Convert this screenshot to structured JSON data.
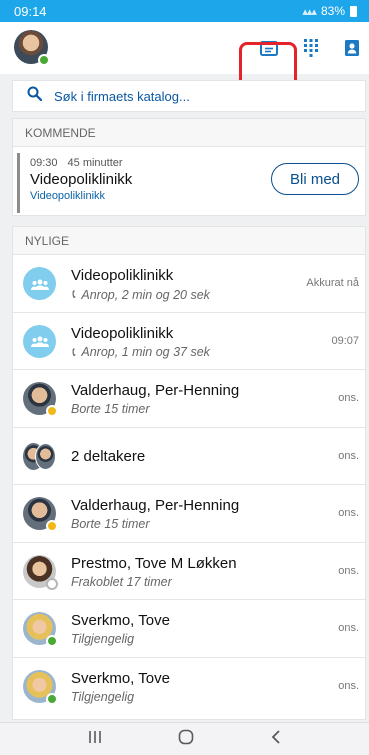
{
  "status_bar": {
    "time": "09:14",
    "battery": "83%"
  },
  "search": {
    "placeholder": "Søk i firmaets katalog..."
  },
  "upcoming": {
    "header": "KOMMENDE",
    "meeting": {
      "time": "09:30",
      "duration": "45 minutter",
      "title": "Videopoliklinikk",
      "subtitle": "Videopoliklinikk",
      "join_label": "Bli med"
    }
  },
  "recent": {
    "header": "NYLIGE",
    "items": [
      {
        "name": "Videopoliklinikk",
        "detail": "Anrop, 2 min og 20 sek",
        "time": "Akkurat nå",
        "avatar": "group-icon"
      },
      {
        "name": "Videopoliklinikk",
        "detail": "Anrop, 1 min og 37 sek",
        "time": "09:07",
        "avatar": "group-icon"
      },
      {
        "name": "Valderhaug, Per-Henning",
        "detail": "Borte 15 timer",
        "time": "ons.",
        "presence": "away"
      },
      {
        "name": "2 deltakere",
        "detail": "",
        "time": "ons."
      },
      {
        "name": "Valderhaug, Per-Henning",
        "detail": "Borte 15 timer",
        "time": "ons.",
        "presence": "away"
      },
      {
        "name": "Prestmo, Tove M Løkken",
        "detail": "Frakoblet 17 timer",
        "time": "ons.",
        "presence": "offline"
      },
      {
        "name": "Sverkmo, Tove",
        "detail": "Tilgjengelig",
        "time": "ons.",
        "presence": "available"
      },
      {
        "name": "Sverkmo, Tove",
        "detail": "Tilgjengelig",
        "time": "ons.",
        "presence": "available"
      }
    ]
  },
  "colors": {
    "status_bar": "#1ea6ea",
    "accent": "#0a58a3",
    "available": "#4aa834",
    "away": "#f2b81a",
    "highlight": "#e5232a"
  }
}
